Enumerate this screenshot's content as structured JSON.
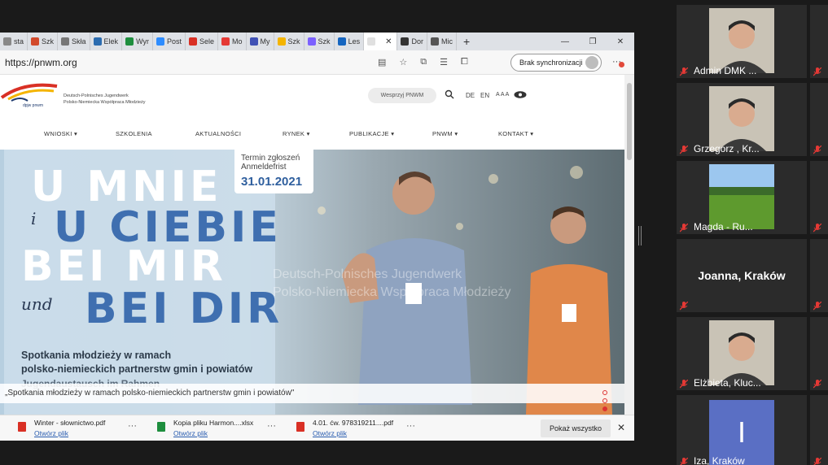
{
  "browser": {
    "tabs": [
      {
        "label": "sta",
        "color": "#888888"
      },
      {
        "label": "Szk",
        "color": "#d24a2c"
      },
      {
        "label": "Skła",
        "color": "#777777"
      },
      {
        "label": "Elek",
        "color": "#2b6cb0"
      },
      {
        "label": "Wyr",
        "color": "#1e8e3e"
      },
      {
        "label": "Post",
        "color": "#2d8cff"
      },
      {
        "label": "Sele",
        "color": "#d93025"
      },
      {
        "label": "Mo",
        "color": "#e53935"
      },
      {
        "label": "My",
        "color": "#3f51b5"
      },
      {
        "label": "Szk",
        "color": "#f4b400"
      },
      {
        "label": "Szk",
        "color": "#7b61ff"
      },
      {
        "label": "Les",
        "color": "#1565c0"
      },
      {
        "label": "",
        "color": "#e0e0e0",
        "active": true,
        "close": "✕"
      },
      {
        "label": "Dor",
        "color": "#333333"
      },
      {
        "label": "Mic",
        "color": "#555555"
      }
    ],
    "new_tab": "+",
    "window_controls": [
      "—",
      "❐",
      "✕"
    ],
    "url": "https://pnwm.org",
    "sync_label": "Brak synchronizacji",
    "more": "···"
  },
  "site": {
    "logo_lines": [
      "Deutsch-Polnisches Jugendwerk",
      "Polsko-Niemiecka Współpraca Młodzieży"
    ],
    "logo_mark": "dpjw pnwm",
    "support_label": "Wesprzyj PNWM",
    "langs": [
      "DE",
      "EN",
      "A A A"
    ],
    "nav": [
      "WNIOSKI",
      "SZKOLENIA",
      "AKTUALNOŚCI",
      "RYNEK",
      "PUBLIKACJE",
      "PNWM",
      "KONTAKT"
    ],
    "nav_has_dropdown": [
      true,
      false,
      false,
      true,
      true,
      true,
      true
    ],
    "deadline": {
      "line1": "Termin zgłoszeń",
      "line2": "Anmeldefrist",
      "date": "31.01.2021"
    },
    "hero": {
      "w1": "U MNIE",
      "w2": "i",
      "w3": "U CIEBIE",
      "w4": "BEI MIR",
      "w5": "und",
      "w6": "BEI DIR",
      "sub1": "Spotkania młodzieży w ramach",
      "sub2": "polsko-niemieckich partnerstw gmin i powiatów",
      "sub3": "Jugendaustausch im Rahmen",
      "watermark1": "Deutsch-Polnisches Jugendwerk",
      "watermark2": "Polsko-Niemiecka Współpraca Młodzieży"
    },
    "caption": "„Spotkania młodzieży w ramach polsko-niemieckich partnerstw gmin i powiatów\""
  },
  "downloads": [
    {
      "name": "Winter - słownictwo.pdf",
      "open": "Otwórz plik",
      "color": "#d93025"
    },
    {
      "name": "Kopia pliku Harmon....xlsx",
      "open": "Otwórz plik",
      "color": "#1e8e3e"
    },
    {
      "name": "4.01. ćw. 978319211....pdf",
      "open": "Otwórz plik",
      "color": "#d93025"
    }
  ],
  "download_show_all": "Pokaż wszystko",
  "download_close": "✕",
  "participants": [
    {
      "name": "Admin DMK ...",
      "type": "video"
    },
    {
      "name": "Grzegorz , Kr...",
      "type": "video"
    },
    {
      "name": "Magda - Ru...",
      "type": "image"
    },
    {
      "name": "Joanna, Kraków",
      "type": "text"
    },
    {
      "name": "Elżbieta, Kluc...",
      "type": "video"
    },
    {
      "name": "Iza, Kraków",
      "type": "initial",
      "initial": "I"
    }
  ]
}
